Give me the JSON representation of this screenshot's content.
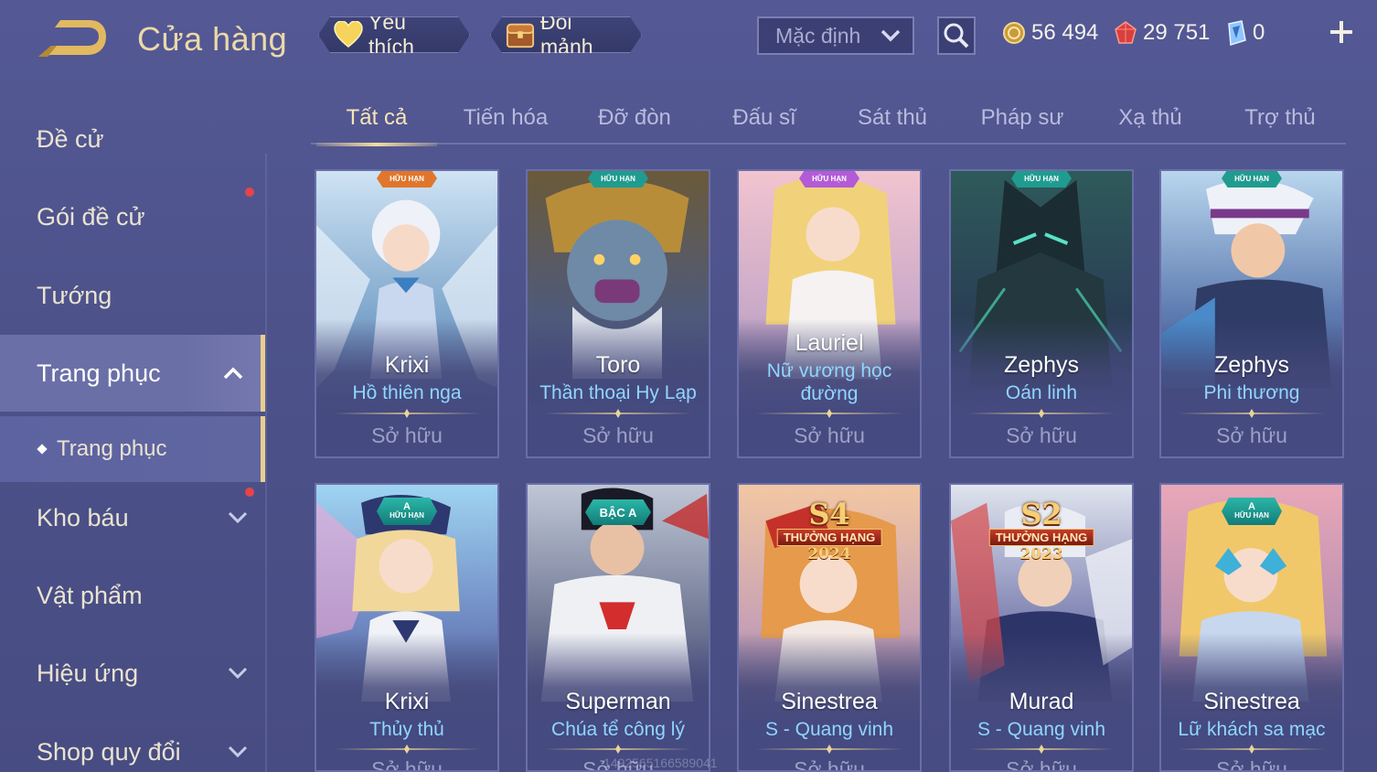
{
  "header": {
    "title": "Cửa hàng",
    "back_icon": "back-arrow-icon",
    "favorites": {
      "label": "Yêu thích",
      "icon": "heart-icon"
    },
    "exchange": {
      "label": "Đổi mảnh",
      "icon": "chest-icon"
    },
    "sort": {
      "value": "Mặc định",
      "icon": "chevron-down-icon"
    },
    "search_icon": "search-icon",
    "currencies": [
      {
        "name": "gold",
        "value": "56 494",
        "icon": "gold-coin-icon",
        "color": "#e0b64e"
      },
      {
        "name": "vouchers",
        "value": "29 751",
        "icon": "red-gem-icon",
        "color": "#e24b4b"
      },
      {
        "name": "quan-huy",
        "value": "0",
        "icon": "blue-crystal-icon",
        "color": "#6fb6ff"
      }
    ],
    "add_icon": "plus-icon"
  },
  "sidebar": {
    "items": [
      {
        "label": "Đề cử"
      },
      {
        "label": "Gói đề cử",
        "badge": true
      },
      {
        "label": "Tướng"
      },
      {
        "label": "Trang phục",
        "expanded": true,
        "active": true
      },
      {
        "label": "Trang phục",
        "sub": true
      },
      {
        "label": "Kho báu",
        "badge": true
      },
      {
        "label": "Vật phẩm"
      },
      {
        "label": "Hiệu ứng"
      },
      {
        "label": "Shop quy đổi"
      }
    ]
  },
  "tabs": [
    "Tất cả",
    "Tiến hóa",
    "Đỡ đòn",
    "Đấu sĩ",
    "Sát thủ",
    "Pháp sư",
    "Xạ thủ",
    "Trợ thủ"
  ],
  "active_tab": "Tất cả",
  "owned_label": "Sở hữu",
  "badges": {
    "limited": "HỮU HẠN",
    "tier_a": "A",
    "bac_a": "BẬC A",
    "ranked": "THƯỞNG HẠNG"
  },
  "cards": [
    {
      "hero": "Krixi",
      "skin": "Hồ thiên nga",
      "badge": "limited",
      "badge_color": "#e0762b"
    },
    {
      "hero": "Toro",
      "skin": "Thần thoại Hy Lạp",
      "badge": "limited",
      "badge_color": "#1f9c8f"
    },
    {
      "hero": "Lauriel",
      "skin": "Nữ vương học đường",
      "badge": "limited",
      "badge_color": "#b35bd6"
    },
    {
      "hero": "Zephys",
      "skin": "Oán linh",
      "badge": "limited",
      "badge_color": "#1f9c8f"
    },
    {
      "hero": "Zephys",
      "skin": "Phi thương",
      "badge": "limited",
      "badge_color": "#1f9c8f"
    },
    {
      "hero": "Krixi",
      "skin": "Thủy thủ",
      "badge": "tier_a"
    },
    {
      "hero": "Superman",
      "skin": "Chúa tể công lý",
      "badge": "bac_a"
    },
    {
      "hero": "Sinestrea",
      "skin": "S - Quang vinh",
      "badge": "ranked",
      "season": "S4",
      "year": "2024"
    },
    {
      "hero": "Murad",
      "skin": "S - Quang vinh",
      "badge": "ranked",
      "season": "S2",
      "year": "2023"
    },
    {
      "hero": "Sinestrea",
      "skin": "Lữ khách sa mạc",
      "badge": "tier_a"
    }
  ],
  "watermark": "1492565166589041"
}
